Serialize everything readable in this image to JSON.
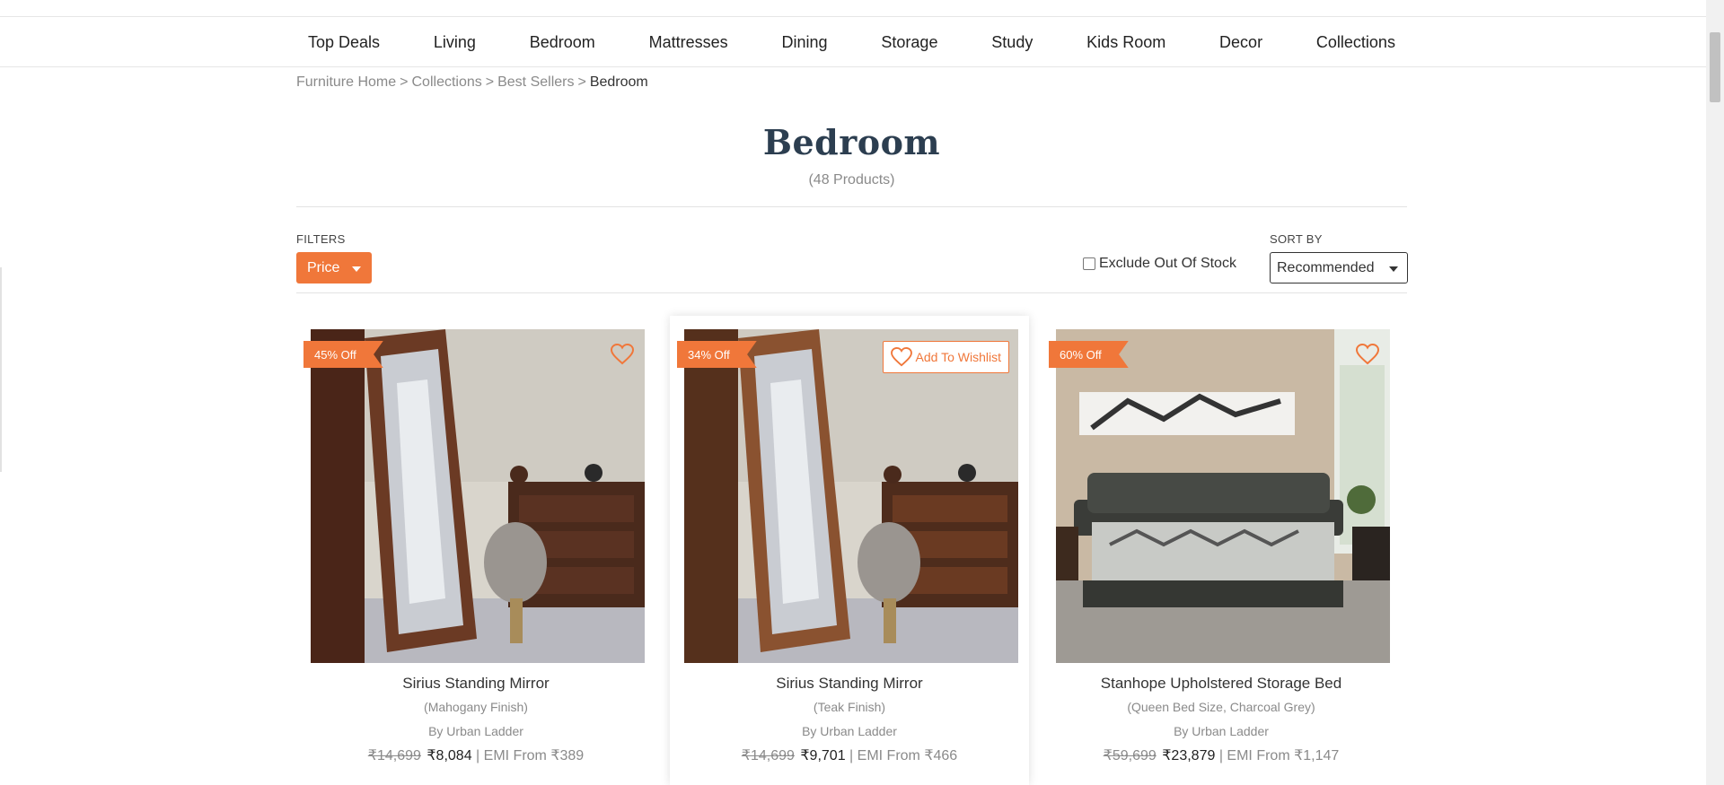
{
  "nav": {
    "items": [
      "Top Deals",
      "Living",
      "Bedroom",
      "Mattresses",
      "Dining",
      "Storage",
      "Study",
      "Kids Room",
      "Decor",
      "Collections"
    ]
  },
  "breadcrumb": {
    "items": [
      "Furniture Home",
      "Collections",
      "Best Sellers"
    ],
    "separator": ">",
    "current": "Bedroom"
  },
  "header": {
    "title": "Bedroom",
    "count": "(48 Products)"
  },
  "filters": {
    "label": "FILTERS",
    "price_label": "Price",
    "exclude_label": "Exclude Out Of Stock",
    "exclude_checked": false,
    "sort_label": "SORT BY",
    "sort_value": "Recommended"
  },
  "products": [
    {
      "discount": "45% Off",
      "name": "Sirius Standing Mirror",
      "variant": "(Mahogany Finish)",
      "brand": "By Urban Ladder",
      "mrp": "₹14,699",
      "price": "₹8,084",
      "emi": "| EMI From ₹389"
    },
    {
      "discount": "34% Off",
      "name": "Sirius Standing Mirror",
      "variant": "(Teak Finish)",
      "brand": "By Urban Ladder",
      "mrp": "₹14,699",
      "price": "₹9,701",
      "emi": "| EMI From ₹466",
      "wishlist_label": "Add To Wishlist"
    },
    {
      "discount": "60% Off",
      "name": "Stanhope Upholstered Storage Bed",
      "variant": "(Queen Bed Size, Charcoal Grey)",
      "brand": "By Urban Ladder",
      "mrp": "₹59,699",
      "price": "₹23,879",
      "emi": "| EMI From ₹1,147"
    }
  ],
  "colors": {
    "accent": "#f0773a",
    "title": "#2c3e50"
  }
}
